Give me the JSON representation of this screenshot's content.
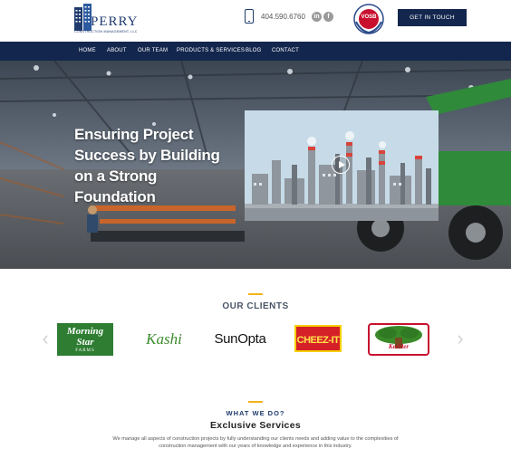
{
  "header": {
    "logo_word": "PERRY",
    "logo_sub": "CONSTRUCTION MANAGEMENT, LLC",
    "phone": "404.590.6760",
    "social": [
      {
        "label": "in",
        "icon": "linkedin-icon"
      },
      {
        "label": "f",
        "icon": "facebook-icon"
      }
    ],
    "badge_text": "VOSB",
    "cta_label": "GET IN TOUCH"
  },
  "nav": {
    "items": [
      "HOME",
      "ABOUT",
      "OUR TEAM",
      "PRODUCTS & SERVICES",
      "BLOG",
      "CONTACT"
    ]
  },
  "hero": {
    "title": "Ensuring Project Success by Building on a Strong Foundation"
  },
  "clients": {
    "title": "OUR CLIENTS",
    "logos": {
      "morningstar": [
        "Morning",
        "Star",
        "FARMS"
      ],
      "kashi": "Kashi",
      "sunopta": "SunOpta",
      "cheezit": "CHEEZ-IT",
      "keebler": "Keebler"
    },
    "prev_arrow": "‹",
    "next_arrow": "›"
  },
  "services": {
    "heading": "WHAT WE DO?",
    "title": "Exclusive Services",
    "description": "We manage all aspects of construction projects by fully understanding our clients needs and adding value to the complexities of construction management with our years of knowledge and experience in this industry."
  },
  "colors": {
    "navy": "#13264d",
    "accent": "#f2b41b",
    "logo_blue": "#1f3b6e"
  }
}
